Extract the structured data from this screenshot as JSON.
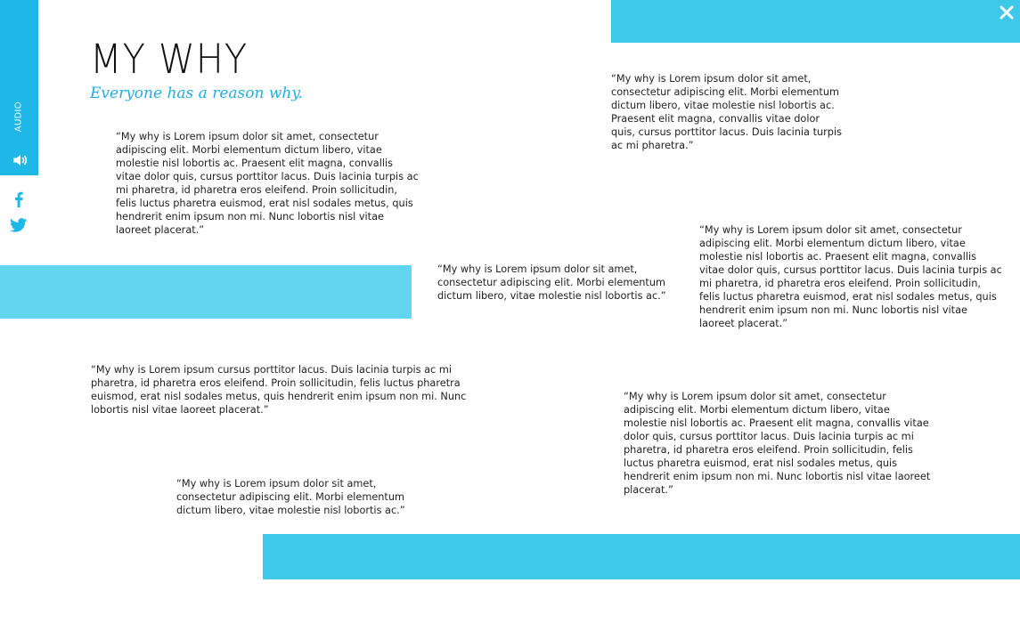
{
  "page": {
    "title": "MY WHY",
    "subtitle": "Everyone has a reason why."
  },
  "sidebar": {
    "audio_label": "AUDIO",
    "icons": [
      "speaker-icon",
      "facebook-icon",
      "twitter-icon"
    ]
  },
  "close_icon": "close-icon",
  "colors": {
    "accent": "#3ec8ea",
    "accent_light": "#62d5f0",
    "sidebar": "#1fb8e6",
    "subtitle": "#22aede"
  },
  "quotes": [
    "“My why is Lorem ipsum dolor sit amet, consectetur adipiscing elit. Morbi elementum dictum libero, vitae molestie nisl lobortis ac. Praesent elit magna, convallis vitae dolor quis, cursus porttitor lacus. Duis lacinia turpis ac mi pharetra, id pharetra eros eleifend. Proin sollicitudin, felis luctus pharetra euismod, erat nisl sodales metus, quis hendrerit enim ipsum non mi. Nunc lobortis nisl vitae laoreet placerat.”",
    "“My why is Lorem ipsum dolor sit amet, consectetur adipiscing elit. Morbi elementum dictum libero, vitae molestie nisl lobortis ac. Praesent elit magna, convallis vitae dolor quis, cursus porttitor lacus. Duis lacinia turpis ac mi pharetra.”",
    "“My why is Lorem ipsum dolor sit amet, consectetur adipiscing elit. Morbi elementum dictum libero, vitae molestie nisl lobortis ac. Praesent elit magna, convallis vitae dolor quis, cursus porttitor lacus. Duis lacinia turpis ac mi pharetra, id pharetra eros eleifend. Proin sollicitudin, felis luctus pharetra euismod, erat nisl sodales metus, quis hendrerit enim ipsum non mi. Nunc lobortis nisl vitae laoreet placerat.”",
    "“My why is Lorem ipsum dolor sit amet, consectetur adipiscing elit. Morbi elementum dictum libero, vitae molestie nisl lobortis ac.”",
    "“My why is Lorem ipsum cursus porttitor lacus. Duis lacinia turpis ac mi pharetra, id pharetra eros eleifend. Proin sollicitudin, felis luctus pharetra euismod, erat nisl sodales metus, quis hendrerit enim ipsum non mi. Nunc lobortis nisl vitae laoreet placerat.”",
    "“My why is Lorem ipsum dolor sit amet, consectetur adipiscing elit. Morbi elementum dictum libero, vitae molestie nisl lobortis ac. Praesent elit magna, convallis vitae dolor quis, cursus porttitor lacus. Duis lacinia turpis ac mi pharetra, id pharetra eros eleifend. Proin sollicitudin, felis luctus pharetra euismod, erat nisl sodales metus, quis hendrerit enim ipsum non mi. Nunc lobortis nisl vitae laoreet placerat.”",
    "“My why is Lorem ipsum dolor sit amet, consectetur adipiscing elit. Morbi elementum dictum libero, vitae molestie nisl lobortis ac.”"
  ]
}
